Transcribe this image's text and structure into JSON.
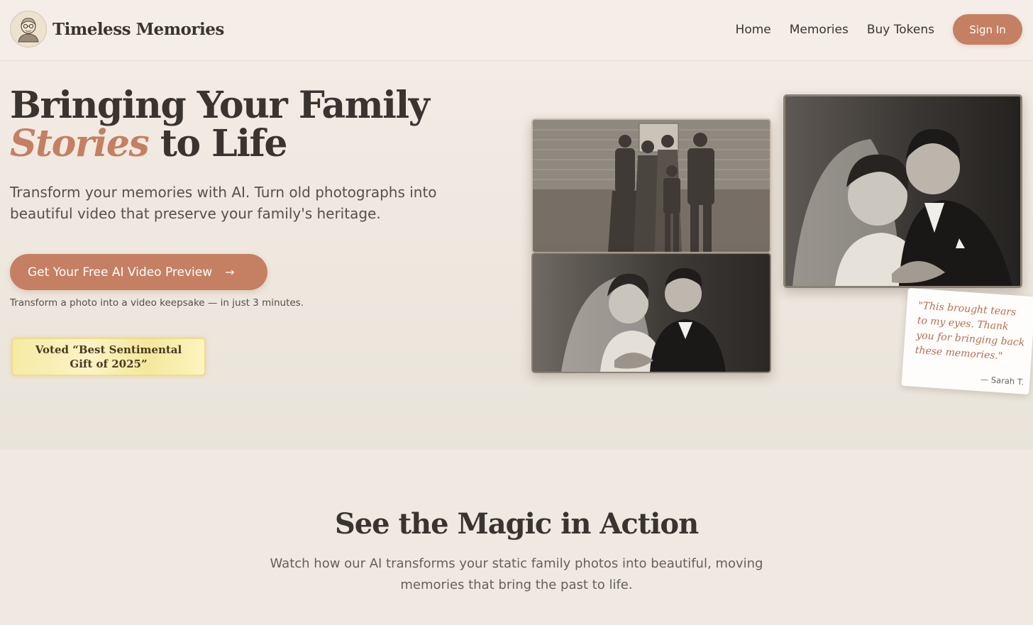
{
  "header": {
    "brand_name": "Timeless Memories",
    "logo_icon": "grandmother-portrait-icon",
    "nav": {
      "home": "Home",
      "memories": "Memories",
      "buy_tokens": "Buy Tokens"
    },
    "sign_in": "Sign In"
  },
  "hero": {
    "headline_line1": "Bringing Your Family",
    "headline_accent": "Stories",
    "headline_rest": " to Life",
    "subtitle": "Transform your memories with AI. Turn old photographs into beautiful video that preserve your family's heritage.",
    "cta_label": "Get Your Free AI Video Preview",
    "cta_icon": "arrow-right-icon",
    "caption": "Transform a photo into a video keepsake — in just 3 minutes.",
    "badge_line1": "Voted “Best Sentimental",
    "badge_line2": "Gift of 2025”",
    "testimonial": {
      "quote": "\"This brought tears to my eyes. Thank you for bringing back these memories.\"",
      "author": "— Sarah T."
    }
  },
  "magic": {
    "title": "See the Magic in Action",
    "subtitle": "Watch how our AI transforms your static family photos into beautiful, moving memories that bring the past to life."
  },
  "colors": {
    "accent": "#c57f62",
    "text": "#3a3431",
    "background": "#efe9e1",
    "badge_gold": "#f6eaa4"
  }
}
